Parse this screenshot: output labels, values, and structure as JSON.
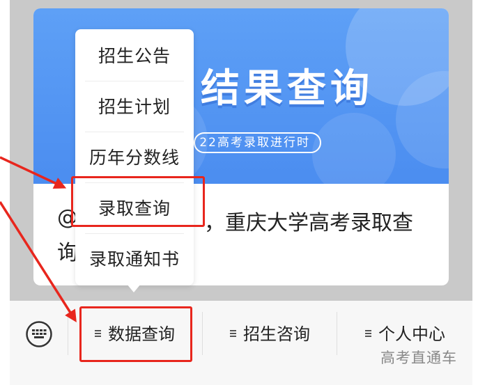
{
  "article": {
    "banner_title": "结果查询",
    "banner_subtitle": "22高考录取进行时",
    "title_line1_start": "@",
    "title_line1_end": "，重庆大学高考录取查",
    "title_line2": "询"
  },
  "popup_menu": {
    "items": [
      {
        "label": "招生公告"
      },
      {
        "label": "招生计划"
      },
      {
        "label": "历年分数线"
      },
      {
        "label": "录取查询"
      },
      {
        "label": "录取通知书"
      }
    ]
  },
  "bottom_bar": {
    "keyboard_icon": "keyboard-icon",
    "menus": [
      {
        "label": "数据查询"
      },
      {
        "label": "招生咨询"
      },
      {
        "label": "个人中心"
      }
    ]
  },
  "watermark": "高考直通车",
  "colors": {
    "annotation_red": "#e8261d",
    "banner_blue": "#4b8df0"
  }
}
